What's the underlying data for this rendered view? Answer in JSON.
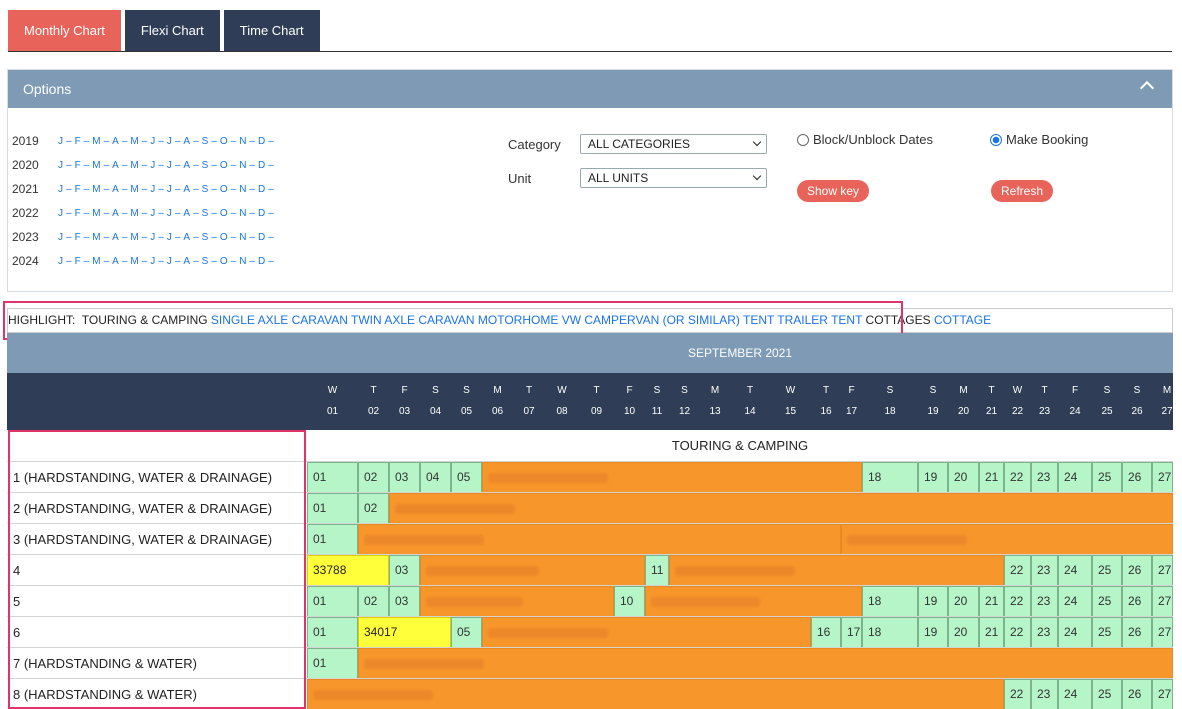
{
  "tabs": [
    "Monthly Chart",
    "Flexi Chart",
    "Time Chart"
  ],
  "options": {
    "title": "Options",
    "years": [
      "2019",
      "2020",
      "2021",
      "2022",
      "2023",
      "2024"
    ],
    "months": [
      "J",
      "F",
      "M",
      "A",
      "M",
      "J",
      "J",
      "A",
      "S",
      "O",
      "N",
      "D"
    ],
    "category_label": "Category",
    "category_value": "ALL CATEGORIES",
    "unit_label": "Unit",
    "unit_value": "ALL UNITS",
    "block_label": "Block/Unblock Dates",
    "booking_label": "Make Booking",
    "show_key": "Show key",
    "refresh": "Refresh"
  },
  "highlight": {
    "prefix": "HIGHLIGHT:",
    "group1": "TOURING & CAMPING",
    "links1": [
      "SINGLE AXLE CARAVAN",
      "TWIN AXLE CARAVAN",
      "MOTORHOME",
      "VW CAMPERVAN (OR SIMILAR)",
      "TENT",
      "TRAILER TENT"
    ],
    "group2": "COTTAGES",
    "links2": [
      "COTTAGE"
    ]
  },
  "chart": {
    "month_title": "SEPTEMBER 2021",
    "days": [
      {
        "l": "W",
        "n": "01"
      },
      {
        "l": "T",
        "n": "02"
      },
      {
        "l": "F",
        "n": "03"
      },
      {
        "l": "S",
        "n": "04"
      },
      {
        "l": "S",
        "n": "05"
      },
      {
        "l": "M",
        "n": "06"
      },
      {
        "l": "T",
        "n": "07"
      },
      {
        "l": "W",
        "n": "08"
      },
      {
        "l": "T",
        "n": "09"
      },
      {
        "l": "F",
        "n": "10"
      },
      {
        "l": "S",
        "n": "11"
      },
      {
        "l": "S",
        "n": "12"
      },
      {
        "l": "M",
        "n": "13"
      },
      {
        "l": "T",
        "n": "14"
      },
      {
        "l": "W",
        "n": "15"
      },
      {
        "l": "T",
        "n": "16"
      },
      {
        "l": "F",
        "n": "17"
      },
      {
        "l": "S",
        "n": "18"
      },
      {
        "l": "S",
        "n": "19"
      },
      {
        "l": "M",
        "n": "20"
      },
      {
        "l": "T",
        "n": "21"
      },
      {
        "l": "W",
        "n": "22"
      },
      {
        "l": "T",
        "n": "23"
      },
      {
        "l": "F",
        "n": "24"
      },
      {
        "l": "S",
        "n": "25"
      },
      {
        "l": "S",
        "n": "26"
      },
      {
        "l": "M",
        "n": "27"
      }
    ],
    "category_title": "TOURING & CAMPING",
    "units": [
      {
        "label": "1 (HARDSTANDING, WATER & DRAINAGE)",
        "cells": [
          {
            "t": "01"
          },
          {
            "t": "02"
          },
          {
            "t": "03"
          },
          {
            "t": "04"
          },
          {
            "t": "05"
          },
          {
            "booked": true,
            "span": 12
          },
          {
            "t": "18"
          },
          {
            "t": "19"
          },
          {
            "t": "20"
          },
          {
            "t": "21"
          },
          {
            "t": "22"
          },
          {
            "t": "23"
          },
          {
            "t": "24"
          },
          {
            "t": "25"
          },
          {
            "t": "26"
          },
          {
            "t": "27"
          }
        ]
      },
      {
        "label": "2 (HARDSTANDING, WATER & DRAINAGE)",
        "cells": [
          {
            "t": "01"
          },
          {
            "t": "02"
          },
          {
            "booked": true,
            "span": 26
          }
        ]
      },
      {
        "label": "3 (HARDSTANDING, WATER & DRAINAGE)",
        "cells": [
          {
            "t": "01"
          },
          {
            "booked": true,
            "span": 15
          },
          {
            "booked": true,
            "span": 12
          }
        ]
      },
      {
        "label": "4",
        "cells": [
          {
            "t": "33788",
            "yellow": true,
            "span": 2
          },
          {
            "t": "03"
          },
          {
            "booked": true,
            "span": 7
          },
          {
            "t": "11"
          },
          {
            "booked": true,
            "span": 10
          },
          {
            "t": "22"
          },
          {
            "t": "23"
          },
          {
            "t": "24"
          },
          {
            "t": "25"
          },
          {
            "t": "26"
          },
          {
            "t": "27"
          }
        ]
      },
      {
        "label": "5",
        "cells": [
          {
            "t": "01"
          },
          {
            "t": "02"
          },
          {
            "t": "03"
          },
          {
            "booked": true,
            "span": 6
          },
          {
            "t": "10"
          },
          {
            "booked": true,
            "span": 7
          },
          {
            "t": "18"
          },
          {
            "t": "19"
          },
          {
            "t": "20"
          },
          {
            "t": "21"
          },
          {
            "t": "22"
          },
          {
            "t": "23"
          },
          {
            "t": "24"
          },
          {
            "t": "25"
          },
          {
            "t": "26"
          },
          {
            "t": "27"
          }
        ]
      },
      {
        "label": "6",
        "cells": [
          {
            "t": "01"
          },
          {
            "t": "34017",
            "yellow": true,
            "span": 3
          },
          {
            "t": "05"
          },
          {
            "booked": true,
            "span": 10
          },
          {
            "t": "16"
          },
          {
            "t": "17"
          },
          {
            "t": "18"
          },
          {
            "t": "19"
          },
          {
            "t": "20"
          },
          {
            "t": "21"
          },
          {
            "t": "22"
          },
          {
            "t": "23"
          },
          {
            "t": "24"
          },
          {
            "t": "25"
          },
          {
            "t": "26"
          },
          {
            "t": "27"
          }
        ]
      },
      {
        "label": "7 (HARDSTANDING & WATER)",
        "cells": [
          {
            "t": "01"
          },
          {
            "booked": true,
            "span": 26
          }
        ]
      },
      {
        "label": "8 (HARDSTANDING & WATER)",
        "cells": [
          {
            "booked": true,
            "span": 21
          },
          {
            "t": "22"
          },
          {
            "t": "23"
          },
          {
            "t": "24"
          },
          {
            "t": "25"
          },
          {
            "t": "26"
          },
          {
            "t": "27"
          }
        ]
      }
    ]
  }
}
